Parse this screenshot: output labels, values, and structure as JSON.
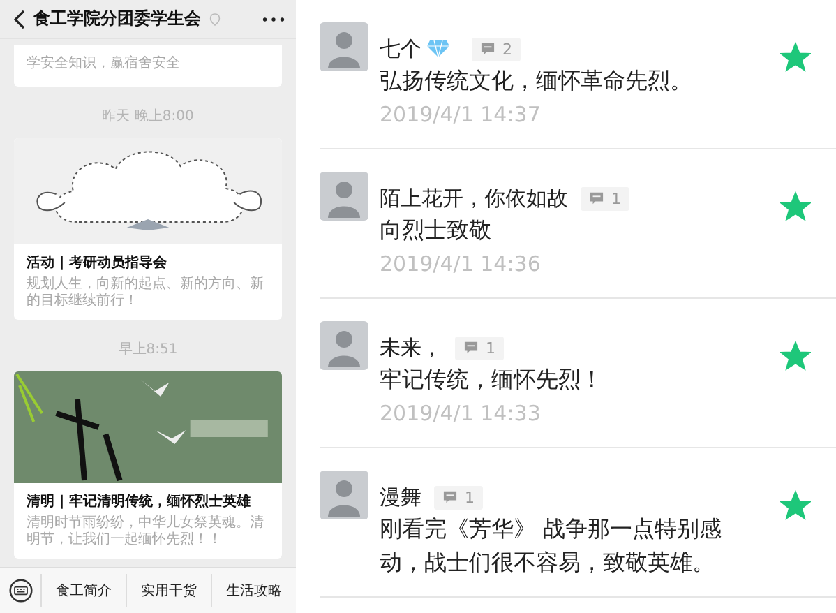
{
  "chat": {
    "title": "食工学院分团委学生会",
    "messages": [
      {
        "kind": "partial",
        "summary": "学安全知识，赢宿舍安全"
      },
      {
        "kind": "time",
        "text": "昨天 晚上8:00"
      },
      {
        "kind": "article",
        "title": "活动 | 考研动员指导会",
        "summary": "规划人生，向新的起点、新的方向、新的目标继续前行！"
      },
      {
        "kind": "time",
        "text": "早上8:51"
      },
      {
        "kind": "article",
        "title": "清明 | 牢记清明传统，缅怀烈士英雄",
        "summary": "清明时节雨纷纷，中华儿女祭英魂。清明节，让我们一起缅怀先烈！！"
      }
    ],
    "menu_bar": [
      "食工简介",
      "实用干货",
      "生活攻略"
    ]
  },
  "comments": [
    {
      "name": "七个",
      "vip": true,
      "replies": "2",
      "text": "弘扬传统文化，缅怀革命先烈。",
      "time": "2019/4/1 14:37",
      "starred": true
    },
    {
      "name": "陌上花开，你依如故",
      "vip": false,
      "replies": "1",
      "text": "向烈士致敬",
      "time": "2019/4/1 14:36",
      "starred": true
    },
    {
      "name": "未来，",
      "vip": false,
      "replies": "1",
      "text": "牢记传统，缅怀先烈！",
      "time": "2019/4/1 14:33",
      "starred": true
    },
    {
      "name": "漫舞",
      "vip": false,
      "replies": "1",
      "text": "刚看完《芳华》 战争那一点特别感动，战士们很不容易，致敬英雄。",
      "starred": true
    }
  ]
}
